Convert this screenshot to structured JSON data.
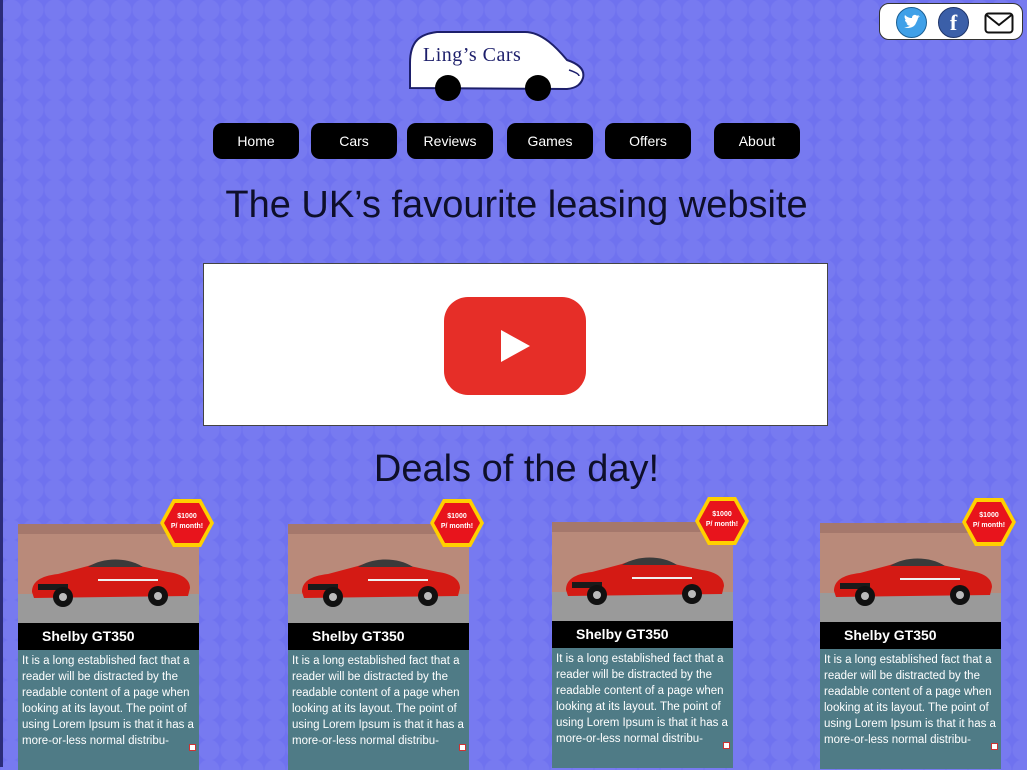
{
  "brand": {
    "name": "Ling’s Cars"
  },
  "social": [
    {
      "name": "twitter-icon"
    },
    {
      "name": "facebook-icon",
      "glyph": "f"
    },
    {
      "name": "mail-icon"
    }
  ],
  "nav": [
    {
      "label": "Home"
    },
    {
      "label": "Cars"
    },
    {
      "label": "Reviews"
    },
    {
      "label": "Games"
    },
    {
      "label": "Offers"
    },
    {
      "label": "About"
    }
  ],
  "hero": {
    "headline": "The UK’s favourite leasing website"
  },
  "video": {
    "icon": "youtube-play-icon"
  },
  "deals": {
    "title": "Deals of the day!",
    "cards": [
      {
        "name": "Shelby GT350",
        "price": "$1000",
        "period": "P/ month!",
        "description": "It is a long established fact that a reader will be distracted by the readable content of a page when looking at its layout. The point of using Lorem Ipsum is that it has a more-or-less normal distribu-"
      },
      {
        "name": "Shelby GT350",
        "price": "$1000",
        "period": "P/ month!",
        "description": "It is a long established fact that a reader will be distracted by the readable content of a page when looking at its layout. The point of using Lorem Ipsum is that it has a more-or-less normal distribu-"
      },
      {
        "name": "Shelby GT350",
        "price": "$1000",
        "period": "P/ month!",
        "description": "It is a long established fact that a reader will be distracted by the readable content of a page when looking at its layout. The point of using Lorem Ipsum is that it has a more-or-less normal distribu-"
      },
      {
        "name": "Shelby GT350",
        "price": "$1000",
        "period": "P/ month!",
        "description": "It is a long established fact that a reader will be distracted by the readable content of a page when looking at its layout. The point of using Lorem Ipsum is that it has a more-or-less normal distribu-"
      }
    ]
  },
  "colors": {
    "background": "#6f72ef",
    "nav": "#000000",
    "card_text_bg": "#4f7b86",
    "badge": "#e8141c",
    "badge_ring": "#ffd000"
  }
}
